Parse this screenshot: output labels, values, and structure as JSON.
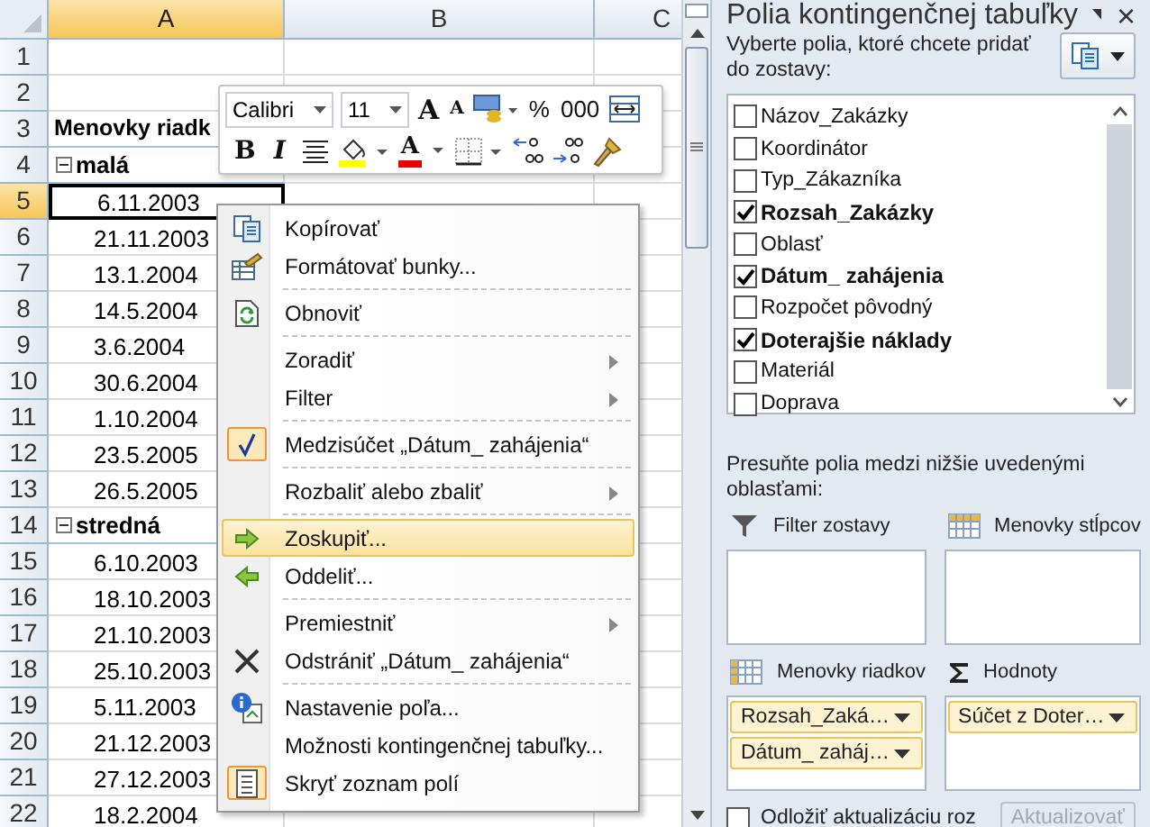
{
  "sheet": {
    "columns": [
      {
        "label": "A",
        "selected": true
      },
      {
        "label": "B",
        "selected": false
      },
      {
        "label": "C",
        "selected": false
      }
    ],
    "rows": [
      {
        "number": "1",
        "selected": false,
        "kind": "blank"
      },
      {
        "number": "2",
        "selected": false,
        "kind": "blank"
      },
      {
        "number": "3",
        "selected": false,
        "kind": "header",
        "a": "Menovky riadk"
      },
      {
        "number": "4",
        "selected": false,
        "kind": "group",
        "a": "malá"
      },
      {
        "number": "5",
        "selected": true,
        "kind": "item",
        "a": "6.11.2003"
      },
      {
        "number": "6",
        "selected": false,
        "kind": "item",
        "a": "21.11.2003"
      },
      {
        "number": "7",
        "selected": false,
        "kind": "item",
        "a": "13.1.2004"
      },
      {
        "number": "8",
        "selected": false,
        "kind": "item",
        "a": "14.5.2004"
      },
      {
        "number": "9",
        "selected": false,
        "kind": "item",
        "a": "3.6.2004"
      },
      {
        "number": "10",
        "selected": false,
        "kind": "item",
        "a": "30.6.2004"
      },
      {
        "number": "11",
        "selected": false,
        "kind": "item",
        "a": "1.10.2004"
      },
      {
        "number": "12",
        "selected": false,
        "kind": "item",
        "a": "23.5.2005"
      },
      {
        "number": "13",
        "selected": false,
        "kind": "item",
        "a": "26.5.2005"
      },
      {
        "number": "14",
        "selected": false,
        "kind": "group",
        "a": "stredná"
      },
      {
        "number": "15",
        "selected": false,
        "kind": "item",
        "a": "6.10.2003"
      },
      {
        "number": "16",
        "selected": false,
        "kind": "item",
        "a": "18.10.2003"
      },
      {
        "number": "17",
        "selected": false,
        "kind": "item",
        "a": "21.10.2003"
      },
      {
        "number": "18",
        "selected": false,
        "kind": "item",
        "a": "25.10.2003"
      },
      {
        "number": "19",
        "selected": false,
        "kind": "item",
        "a": "5.11.2003"
      },
      {
        "number": "20",
        "selected": false,
        "kind": "item",
        "a": "21.12.2003"
      },
      {
        "number": "21",
        "selected": false,
        "kind": "item",
        "a": "27.12.2003"
      },
      {
        "number": "22",
        "selected": false,
        "kind": "item",
        "a": "18.2.2004"
      }
    ]
  },
  "mini_toolbar": {
    "font": "Calibri",
    "size": "11",
    "grow": "A",
    "shrink": "A",
    "percent": "%",
    "thousands": "000",
    "bold": "B",
    "italic": "I",
    "font_color": "A"
  },
  "context_menu": [
    {
      "kind": "item",
      "label": "Kopírovať",
      "submenu": false,
      "checked": false,
      "selected": false
    },
    {
      "kind": "item",
      "label": "Formátovať bunky...",
      "submenu": false,
      "checked": false,
      "selected": false
    },
    {
      "kind": "separator"
    },
    {
      "kind": "item",
      "label": "Obnoviť",
      "submenu": false,
      "checked": false,
      "selected": false
    },
    {
      "kind": "separator"
    },
    {
      "kind": "item",
      "label": "Zoradiť",
      "submenu": true,
      "checked": false,
      "selected": false
    },
    {
      "kind": "item",
      "label": "Filter",
      "submenu": true,
      "checked": false,
      "selected": false
    },
    {
      "kind": "separator"
    },
    {
      "kind": "item",
      "label": "Medzisúčet „Dátum_ zahájenia“",
      "submenu": false,
      "checked": true,
      "selected": false
    },
    {
      "kind": "separator"
    },
    {
      "kind": "item",
      "label": "Rozbaliť alebo zbaliť",
      "submenu": true,
      "checked": false,
      "selected": false
    },
    {
      "kind": "separator"
    },
    {
      "kind": "item",
      "label": "Zoskupiť...",
      "submenu": false,
      "checked": false,
      "selected": true
    },
    {
      "kind": "item",
      "label": "Oddeliť...",
      "submenu": false,
      "checked": false,
      "selected": false
    },
    {
      "kind": "separator"
    },
    {
      "kind": "item",
      "label": "Premiestniť",
      "submenu": true,
      "checked": false,
      "selected": false
    },
    {
      "kind": "item",
      "label": "Odstrániť „Dátum_ zahájenia“",
      "submenu": false,
      "checked": false,
      "selected": false
    },
    {
      "kind": "separator"
    },
    {
      "kind": "item",
      "label": "Nastavenie poľa...",
      "submenu": false,
      "checked": false,
      "selected": false
    },
    {
      "kind": "item",
      "label": "Možnosti kontingenčnej tabuľky...",
      "submenu": false,
      "checked": false,
      "selected": false
    },
    {
      "kind": "item",
      "label": "Skryť zoznam polí",
      "submenu": false,
      "checked": true,
      "selected": false
    }
  ],
  "pane": {
    "title": "Polia kontingenčnej tabuľky",
    "close": "×",
    "instruction": "Vyberte polia, ktoré chcete pridať do zostavy:",
    "fields": [
      {
        "label": "Názov_Zakázky",
        "checked": false
      },
      {
        "label": "Koordinátor",
        "checked": false
      },
      {
        "label": "Typ_Zákazníka",
        "checked": false
      },
      {
        "label": "Rozsah_Zakázky",
        "checked": true
      },
      {
        "label": "Oblasť",
        "checked": false
      },
      {
        "label": "Dátum_ zahájenia",
        "checked": true
      },
      {
        "label": "Rozpočet pôvodný",
        "checked": false
      },
      {
        "label": "Doterajšie náklady",
        "checked": true
      },
      {
        "label": "Materiál",
        "checked": false
      },
      {
        "label": "Doprava",
        "checked": false
      }
    ],
    "areas_hint": "Presuňte polia medzi nižšie uvedenými oblasťami:",
    "areas": [
      {
        "kind": "filter",
        "title": "Filter zostavy"
      },
      {
        "kind": "columns",
        "title": "Menovky stĺpcov"
      },
      {
        "kind": "rows",
        "title": "Menovky riadkov",
        "items": [
          "Rozsah_Zaká…",
          "Dátum_ zaháj…"
        ]
      },
      {
        "kind": "values",
        "title": "Hodnoty",
        "items": [
          "Súčet z Doter…"
        ]
      }
    ],
    "defer": {
      "label": "Odložiť aktualizáciu roz",
      "checked": false
    },
    "update": {
      "label": "Aktualizovať",
      "disabled": true
    }
  }
}
